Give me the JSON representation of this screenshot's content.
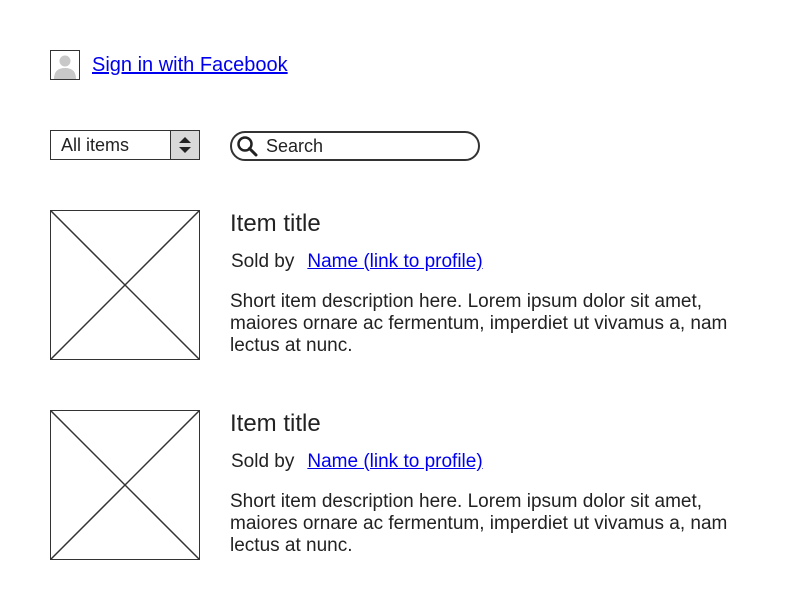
{
  "account": {
    "signin_label": "Sign in with Facebook",
    "avatar_icon": "user-placeholder-icon"
  },
  "filter": {
    "selected": "All items",
    "icon": "updown-arrows-icon"
  },
  "search": {
    "placeholder": "Search",
    "value": "",
    "icon": "search-icon"
  },
  "items": [
    {
      "title": "Item title",
      "sold_by_label": "Sold by",
      "seller": "Name (link to profile)",
      "description": "Short item description here. Lorem ipsum dolor sit amet, maiores ornare ac fermentum, imperdiet ut vivamus a, nam lectus at nunc.",
      "image_icon": "image-placeholder-icon"
    },
    {
      "title": "Item title",
      "sold_by_label": "Sold by",
      "seller": "Name (link to profile)",
      "description": "Short item description here. Lorem ipsum dolor sit amet, maiores ornare ac fermentum, imperdiet ut vivamus a, nam lectus at nunc.",
      "image_icon": "image-placeholder-icon"
    }
  ],
  "colors": {
    "link": "#0000ee",
    "border": "#333333",
    "text": "#222222",
    "spinner_bg": "#d9d9d9"
  }
}
